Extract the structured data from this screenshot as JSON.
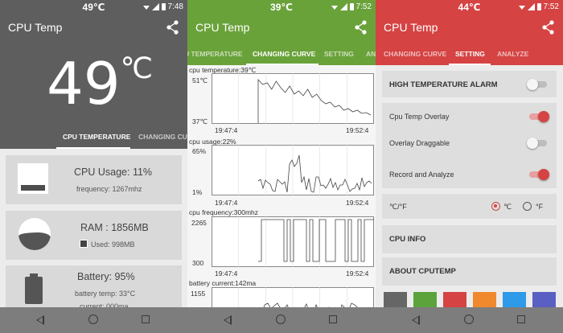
{
  "app_title": "CPU Temp",
  "status_time_1": "7:48",
  "status_time_2": "7:52",
  "status_time_3": "7:52",
  "status_temp_1": "49℃",
  "status_temp_2": "39℃",
  "status_temp_3": "44℃",
  "tabs": {
    "cpu_temperature": "CPU TEMPERATURE",
    "changing_curve": "CHANGING CURVE",
    "setting": "SETTING",
    "analyze": "ANALYZE",
    "p1_changing_partial": "CHANGING CUR",
    "p2_cpu_partial": "U TEMPERATURE",
    "p2_analyze_partial": "AN"
  },
  "panel1": {
    "big_temp": "49",
    "big_unit": "℃",
    "cpu_usage": "CPU Usage: 11%",
    "frequency": "frequency: 1267mhz",
    "ram": "RAM : 1856MB",
    "ram_used": "Used: 998MB",
    "battery": "Battery: 95%",
    "battery_temp": "battery temp: 33°C",
    "battery_current_partial": "current: 000ma"
  },
  "panel2": {
    "charts": [
      {
        "title": "cpu temperature:39℃",
        "ymax": "51℃",
        "ymin": "37℃",
        "t0": "19:47:4",
        "t1": "19:52:4"
      },
      {
        "title": "cpu usage:22%",
        "ymax": "65%",
        "ymin": "1%",
        "t0": "19:47:4",
        "t1": "19:52:4"
      },
      {
        "title": "cpu frequency:300mhz",
        "ymax": "2265",
        "ymin": "300",
        "t0": "19:47:4",
        "t1": "19:52:4"
      },
      {
        "title": "battery current:142ma",
        "ymax": "1155",
        "ymin": "",
        "t0": "",
        "t1": ""
      }
    ]
  },
  "panel3": {
    "high_temp_alarm": "HIGH TEMPERATURE ALARM",
    "overlay": "Cpu Temp Overlay",
    "overlay_draggable": "Overlay Draggable",
    "record_analyze": "Record and Analyze",
    "unit_label": "℃/°F",
    "celsius": "℃",
    "fahrenheit": "°F",
    "cpu_info": "CPU INFO",
    "about": "ABOUT CPUTEMP",
    "toggles": {
      "high_temp_alarm": false,
      "overlay": true,
      "overlay_draggable": false,
      "record_analyze": true
    },
    "unit_selected": "celsius"
  },
  "colors": {
    "gray": "#5e5e5e",
    "green": "#6aa23a",
    "red": "#d54343",
    "swatches": [
      "#666666",
      "#5ba33a",
      "#d54343",
      "#f0892e",
      "#2f9ae8",
      "#5a5fc4"
    ]
  },
  "icons": [
    "share-icon",
    "wifi-icon",
    "signal-icon",
    "battery-icon",
    "back-icon",
    "home-icon",
    "recent-apps-icon",
    "cpu-icon",
    "ram-icon",
    "battery-level-icon"
  ]
}
